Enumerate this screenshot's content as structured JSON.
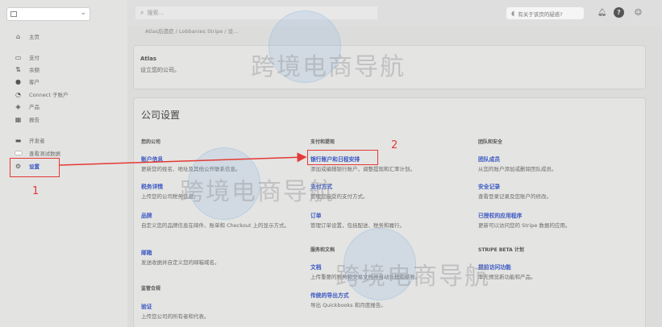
{
  "sidebar": {
    "account_value": "",
    "items": [
      {
        "key": "home",
        "label": "主页",
        "icon": "home-icon"
      },
      {
        "key": "payments",
        "label": "支付",
        "icon": "payments-icon"
      },
      {
        "key": "balance",
        "label": "余额",
        "icon": "balance-icon"
      },
      {
        "key": "customers",
        "label": "客户",
        "icon": "customers-icon"
      },
      {
        "key": "connect",
        "label": "Connect 子账户",
        "icon": "connect-icon"
      },
      {
        "key": "products",
        "label": "产品",
        "icon": "products-icon"
      },
      {
        "key": "reports",
        "label": "报告",
        "icon": "reports-icon"
      },
      {
        "key": "developers",
        "label": "开发者",
        "icon": "developers-icon"
      },
      {
        "key": "test_data",
        "label": "查看测试数据",
        "icon": "toggle-icon"
      },
      {
        "key": "settings",
        "label": "设置",
        "icon": "gear-icon"
      }
    ]
  },
  "topbar": {
    "search_placeholder": "搜索...",
    "help_label": "有关于该页的疑惑?",
    "bell_icon": "bell-icon",
    "help_icon": "help-icon",
    "user_icon": "user-icon"
  },
  "main": {
    "breadcrumb": "Atlas后遗症 / Lobbanies Stripe / 设...",
    "atlas": {
      "title": "Atlas",
      "desc": "设立您的公司。"
    },
    "settings_title": "公司设置",
    "columns": {
      "company": {
        "heading": "您的公司",
        "items": [
          {
            "title": "账户信息",
            "desc": "更新您的姓名、地址及其他公开联系信息。"
          },
          {
            "title": "税务详情",
            "desc": "上传您的公司税务信息。"
          },
          {
            "title": "品牌",
            "desc": "自定义您的品牌信息在邮件、账单和 Checkout 上的显示方式。"
          },
          {
            "title": "邮箱",
            "desc": "发送收据并自定义您的邮箱域名。"
          }
        ]
      },
      "compliance": {
        "heading": "监管合规",
        "items": [
          {
            "title": "验证",
            "desc": "上传您公司的所有者和代表。"
          }
        ]
      },
      "payments": {
        "heading": "支付和提现",
        "items": [
          {
            "title": "银行账户和日程安排",
            "desc": "添加或编辑银行账户，调整提现和汇率计划。"
          },
          {
            "title": "支付方式",
            "desc": "管理您接受的支付方式。"
          },
          {
            "title": "订单",
            "desc": "管理订单设置，包括配送、税务和履行。"
          }
        ]
      },
      "services": {
        "heading": "服务和文档",
        "items": [
          {
            "title": "文档",
            "desc": "上传重要的税务和交易文档并自动计税和结账。"
          },
          {
            "title": "传统的导出方式",
            "desc": "导出 Quickbooks 和月度报告。"
          }
        ]
      },
      "team": {
        "heading": "团队和安全",
        "items": [
          {
            "title": "团队成员",
            "desc": "从您的账户添加或删除团队成员。"
          },
          {
            "title": "安全记录",
            "desc": "查看登录记录及您账户的修改。"
          },
          {
            "title": "已授权的应用程序",
            "desc": "更新可以访问您的 Stripe 数据的应用。"
          }
        ]
      },
      "beta": {
        "heading": "STRIPE BETA 计划",
        "items": [
          {
            "title": "提前访问功能",
            "desc": "率先预览新功能和产品。"
          }
        ]
      }
    }
  },
  "annotations": {
    "step1": "1",
    "step2": "2",
    "color": "#e53935"
  },
  "watermark": {
    "text": "跨境电商导航"
  },
  "colors": {
    "link": "#3a57c4",
    "background": "#dcdcda"
  }
}
